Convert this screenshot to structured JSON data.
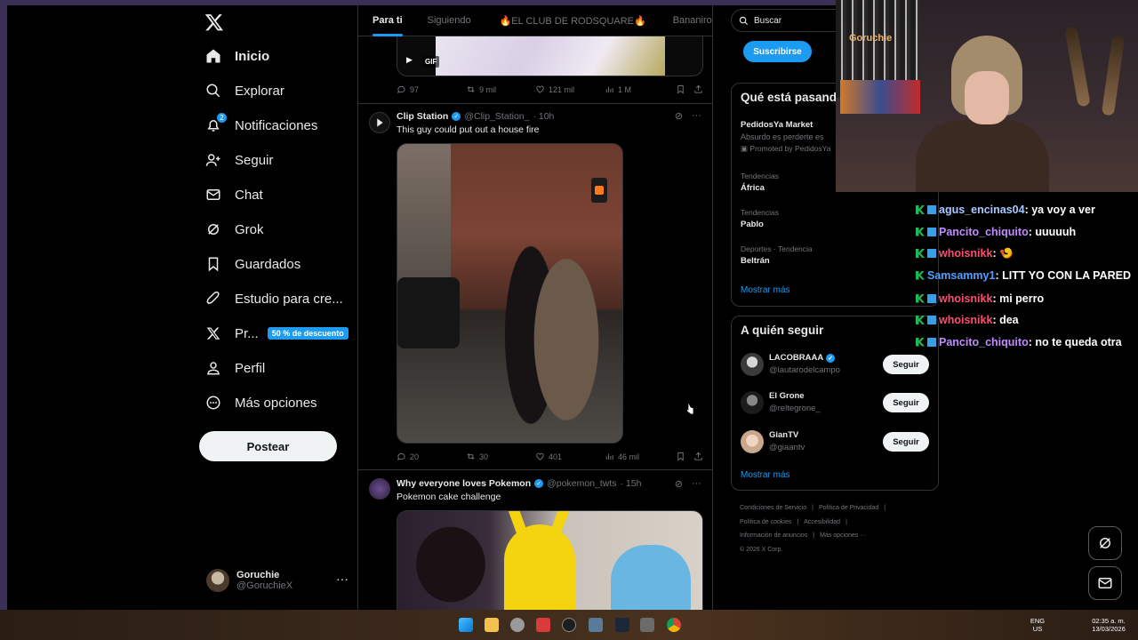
{
  "nav": {
    "items": [
      {
        "label": "Inicio"
      },
      {
        "label": "Explorar"
      },
      {
        "label": "Notificaciones",
        "badge": "2"
      },
      {
        "label": "Seguir"
      },
      {
        "label": "Chat"
      },
      {
        "label": "Grok"
      },
      {
        "label": "Guardados"
      },
      {
        "label": "Estudio para cre..."
      },
      {
        "label": "Pr...",
        "promo": "50 % de descuento"
      },
      {
        "label": "Perfil"
      },
      {
        "label": "Más opciones"
      }
    ],
    "post_button": "Postear",
    "profile": {
      "name": "Goruchie",
      "handle": "@GoruchieX"
    }
  },
  "feed": {
    "tabs": [
      "Para ti",
      "Siguiendo",
      "🔥EL CLUB DE RODSQUARE🔥",
      "Bananirou"
    ],
    "gif_label": "GIF",
    "posts": [
      {
        "stats": {
          "replies": "97",
          "reposts": "9 mil",
          "likes": "121 mil",
          "views": "1 M"
        }
      },
      {
        "name": "Clip Station",
        "handle": "@Clip_Station_",
        "time": "· 10h",
        "text": "This guy could put out a house fire",
        "stats": {
          "replies": "20",
          "reposts": "30",
          "likes": "401",
          "views": "46 mil"
        }
      },
      {
        "name": "Why everyone loves Pokemon",
        "handle": "@pokemon_twts",
        "time": "· 15h",
        "text": "Pokemon cake challenge"
      }
    ]
  },
  "right": {
    "search_placeholder": "Buscar",
    "subscribe": "Suscribirse",
    "trends_title": "Qué está pasando",
    "promoted": {
      "name": "PedidosYa Market",
      "desc": "Absurdo es perderte es",
      "meta": "Promoted by PedidosYa"
    },
    "trends": [
      {
        "meta": "Tendencias",
        "name": "África"
      },
      {
        "meta": "Tendencias",
        "name": "Pablo"
      },
      {
        "meta": "Deportes · Tendencia",
        "name": "Beltrán"
      }
    ],
    "show_more": "Mostrar más",
    "follow_title": "A quién seguir",
    "follow": [
      {
        "name": "LACOBRAAA",
        "handle": "@lautarodelcampo",
        "button": "Seguir"
      },
      {
        "name": "El Grone",
        "handle": "@reltegrone_",
        "button": "Seguir"
      },
      {
        "name": "GianTV",
        "handle": "@giaantv",
        "button": "Seguir"
      }
    ],
    "follow_more": "Mostrar más",
    "footer": [
      "Condiciones de Servicio",
      "|",
      "Política de Privacidad",
      "|",
      "Política de cookies",
      "|",
      "Accesibilidad",
      "|",
      "Información de anuncios",
      "|",
      "Más opciones ···",
      "© 2026 X Corp."
    ]
  },
  "stream": {
    "cam_label": "Goruchie",
    "chat": [
      {
        "user": "agus_encinas04",
        "color": "#a8c8ff",
        "msg": ": ya voy a ver",
        "badges": [
          "g",
          "b"
        ]
      },
      {
        "user": "Pancito_chiquito",
        "color": "#c08cff",
        "msg": ": uuuuuh",
        "badges": [
          "g",
          "b"
        ]
      },
      {
        "user": "whoisnikk",
        "color": "#ff4d6d",
        "msg": ": 🍤",
        "badges": [
          "g",
          "b"
        ]
      },
      {
        "user": "Samsammy1",
        "color": "#4ea0ff",
        "msg": ": LITT YO CON LA PARED",
        "badges": [
          "g"
        ]
      },
      {
        "user": "whoisnikk",
        "color": "#ff4d6d",
        "msg": ": mi perro",
        "badges": [
          "g",
          "b"
        ]
      },
      {
        "user": "whoisnikk",
        "color": "#ff4d6d",
        "msg": ": dea",
        "badges": [
          "g",
          "b"
        ]
      },
      {
        "user": "Pancito_chiquito",
        "color": "#c08cff",
        "msg": ": no te queda otra",
        "badges": [
          "g",
          "b"
        ]
      }
    ]
  },
  "taskbar": {
    "lang": "ENG",
    "region": "US",
    "time": "02:35 a. m.",
    "date": "13/03/2026"
  }
}
